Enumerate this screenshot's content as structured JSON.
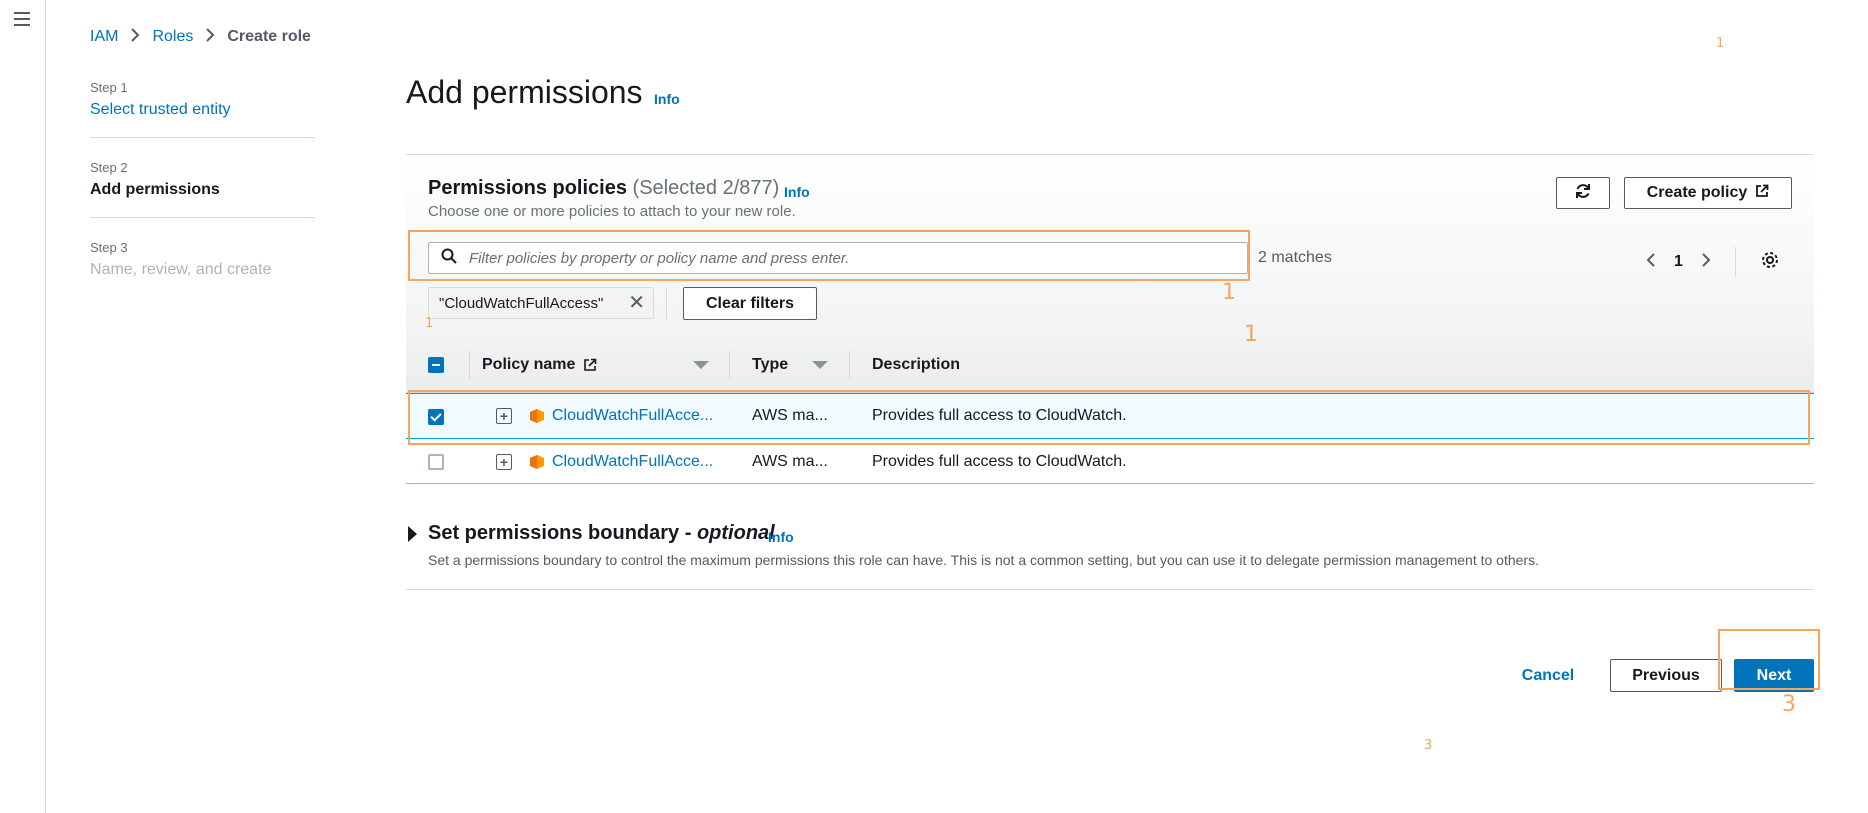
{
  "nav": {
    "menu_icon": "hamburger-menu-icon"
  },
  "breadcrumb": {
    "items": [
      "IAM",
      "Roles"
    ],
    "current": "Create role",
    "separator_icon": "chevron-right-icon"
  },
  "steps": [
    {
      "num": "Step 1",
      "title": "Select trusted entity"
    },
    {
      "num": "Step 2",
      "title": "Add permissions"
    },
    {
      "num": "Step 3",
      "title": "Name, review, and create"
    }
  ],
  "page": {
    "title": "Add permissions",
    "info": "Info"
  },
  "policies": {
    "title": "Permissions policies",
    "count": "(Selected 2/877)",
    "info": "Info",
    "description": "Choose one or more policies to attach to your new role.",
    "create_policy_label": "Create policy",
    "search_placeholder": "Filter policies by property or policy name and press enter.",
    "matches": "2 matches",
    "page_number": "1",
    "filter_token": "\"CloudWatchFullAccess\"",
    "clear_filters_label": "Clear filters",
    "columns": [
      "Policy name",
      "Type",
      "Description"
    ],
    "rows": [
      {
        "name": "CloudWatchFullAcce...",
        "type": "AWS ma...",
        "description": "Provides full access to CloudWatch.",
        "checked": true
      },
      {
        "name": "CloudWatchFullAcce...",
        "type": "AWS ma...",
        "description": "Provides full access to CloudWatch.",
        "checked": false
      }
    ]
  },
  "boundary": {
    "title_prefix": "Set permissions boundary - ",
    "title_optional": "optional",
    "info": "Info",
    "description": "Set a permissions boundary to control the maximum permissions this role can have. This is not a common setting, but you can use it to delegate permission management to others."
  },
  "footer": {
    "cancel_label": "Cancel",
    "previous_label": "Previous",
    "next_label": "Next"
  },
  "annotations": {
    "one": "1",
    "three": "3"
  },
  "colors": {
    "accent": "#0073bb",
    "annotation": "#f6a55c",
    "aws_orange": "#ff9900"
  }
}
